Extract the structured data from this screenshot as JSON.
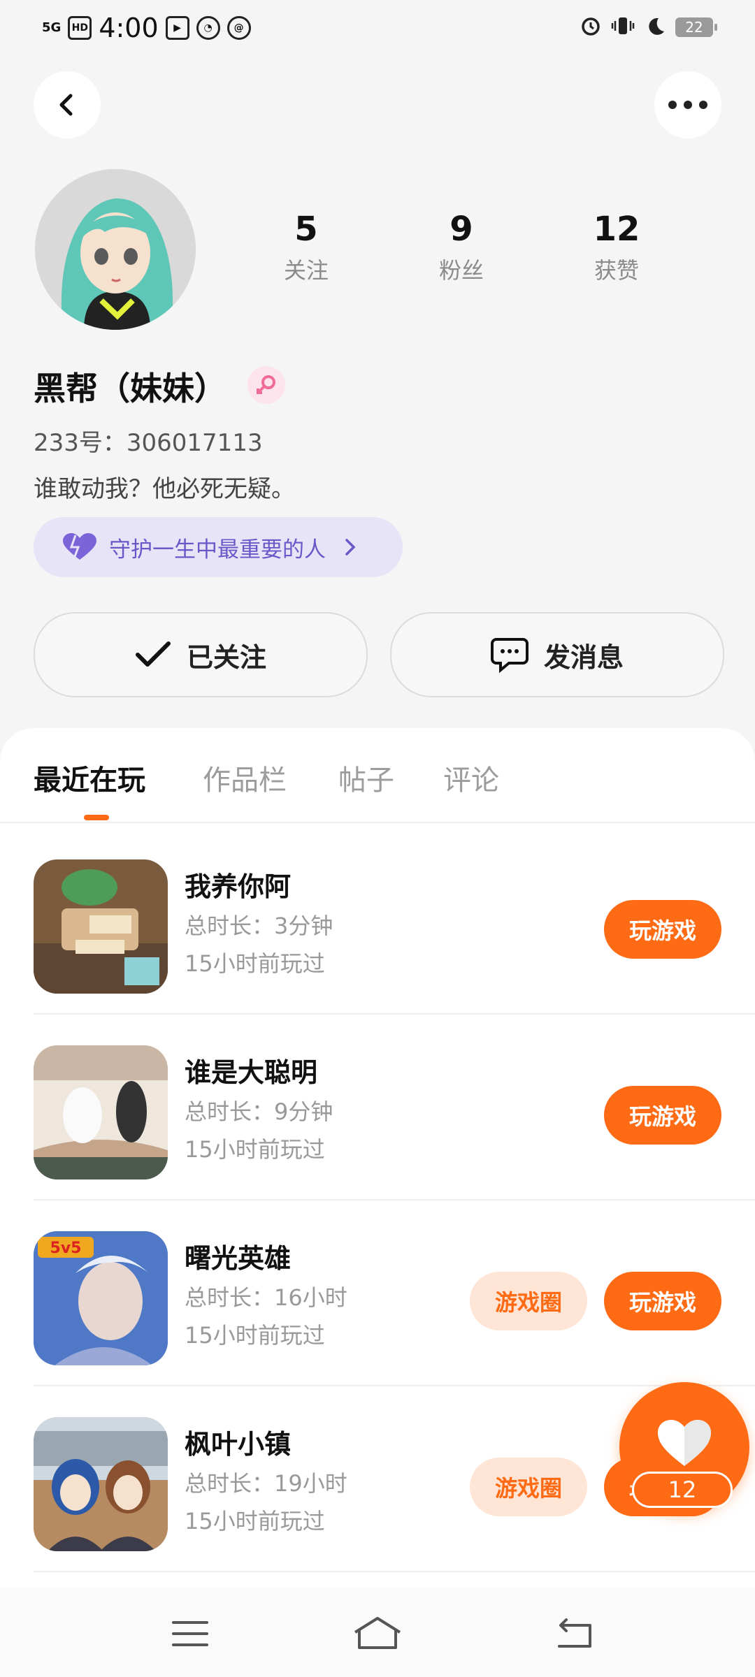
{
  "status_bar": {
    "network": "5G",
    "hd": "HD",
    "time": "4:00",
    "battery": "22"
  },
  "profile": {
    "stats": [
      {
        "value": "5",
        "label": "关注"
      },
      {
        "value": "9",
        "label": "粉丝"
      },
      {
        "value": "12",
        "label": "获赞"
      }
    ],
    "nickname": "黑帮（妹妹）",
    "gender_icon": "female-icon",
    "uid": "233号：306017113",
    "bio": "谁敢动我？他必死无疑。",
    "guard_label": "守护一生中最重要的人"
  },
  "actions": {
    "followed_label": "已关注",
    "message_label": "发消息"
  },
  "tabs": [
    {
      "label": "最近在玩",
      "active": true
    },
    {
      "label": "作品栏",
      "active": false
    },
    {
      "label": "帖子",
      "active": false
    },
    {
      "label": "评论",
      "active": false
    }
  ],
  "games": [
    {
      "name": "我养你阿",
      "duration": "总时长：3分钟",
      "last_played": "15小时前玩过",
      "play_label": "玩游戏"
    },
    {
      "name": "谁是大聪明",
      "duration": "总时长：9分钟",
      "last_played": "15小时前玩过",
      "play_label": "玩游戏"
    },
    {
      "name": "曙光英雄",
      "duration": "总时长：16小时",
      "last_played": "15小时前玩过",
      "circle_label": "游戏圈",
      "play_label": "玩游戏"
    },
    {
      "name": "枫叶小镇",
      "duration": "总时长：19小时",
      "last_played": "15小时前玩过",
      "circle_label": "游戏圈",
      "play_label": "玩游戏"
    }
  ],
  "fab": {
    "count": "12",
    "icon": "heart-icon"
  },
  "colors": {
    "accent": "#ff6a14",
    "guard": "#6a58c8"
  }
}
